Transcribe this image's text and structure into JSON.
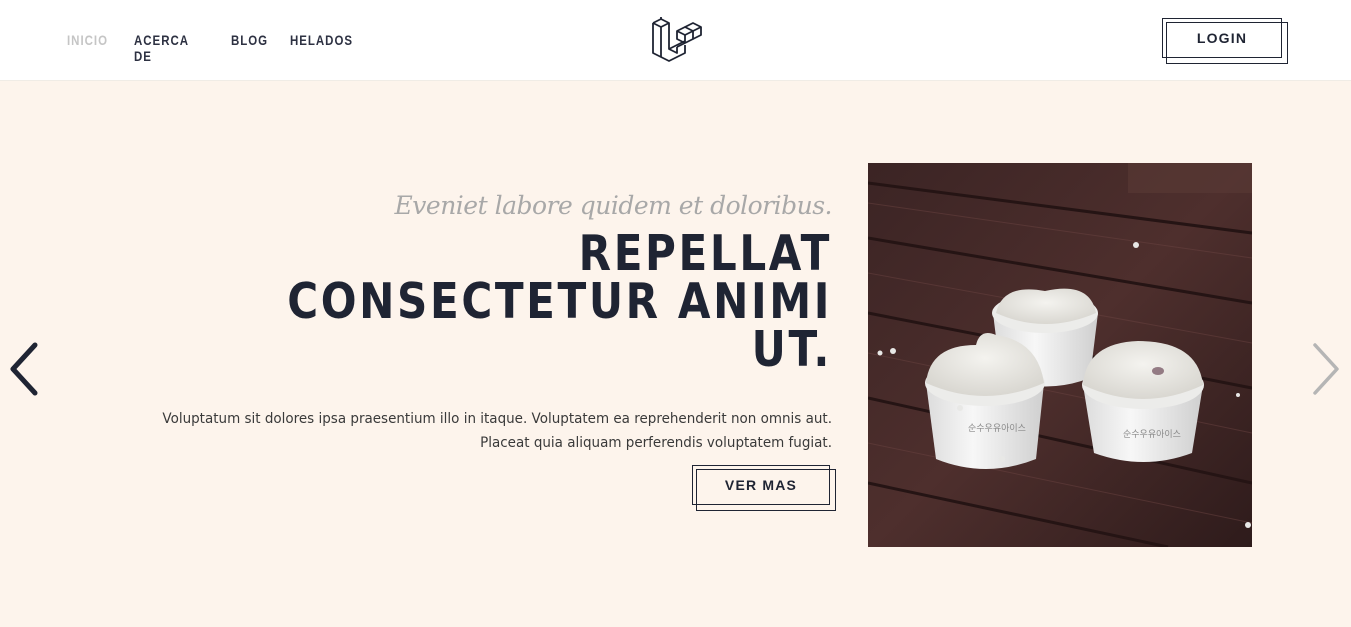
{
  "nav": {
    "items": [
      {
        "label": "INICIO",
        "active": true
      },
      {
        "label": "ACERCA DE",
        "active": false
      },
      {
        "label": "BLOG",
        "active": false
      },
      {
        "label": "HELADOS",
        "active": false
      }
    ]
  },
  "logo": {
    "icon": "laravel-logo-icon"
  },
  "header": {
    "login_label": "LOGIN"
  },
  "hero": {
    "subtitle": "Eveniet labore quidem et doloribus.",
    "title": "REPELLAT CONSECTETUR ANIMI UT.",
    "description_line1": "Voluptatum sit dolores ipsa praesentium illo in itaque. Voluptatem ea reprehenderit non omnis aut.",
    "description_line2": "Placeat quia aliquam perferendis voluptatem fugiat.",
    "button_label": "VER MAS",
    "image": "ice-cream-cups-on-wooden-table"
  },
  "carousel": {
    "prev_icon": "chevron-left-icon",
    "next_icon": "chevron-right-icon"
  },
  "colors": {
    "hero_bg": "#fdf4ec",
    "dark": "#1f2433",
    "nav_active": "#c5c5c5"
  }
}
